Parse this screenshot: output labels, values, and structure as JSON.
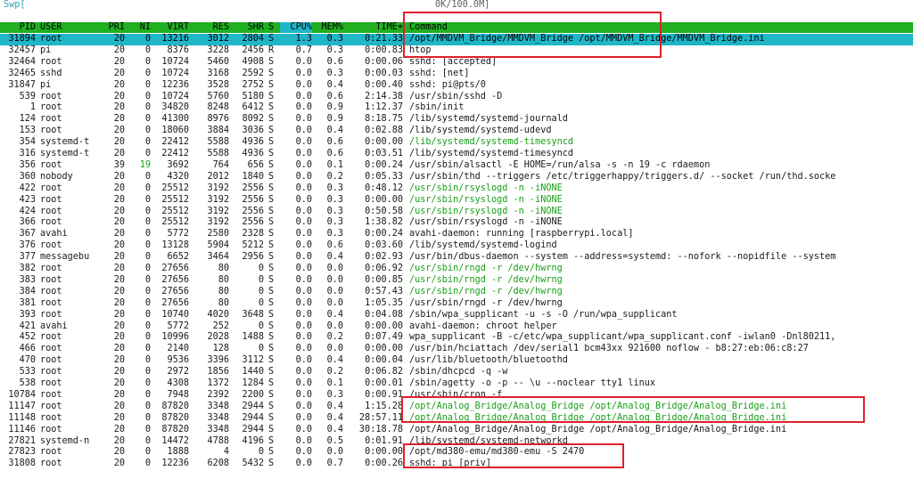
{
  "swap": {
    "label": "Swp[",
    "value": "0K/100.0M]"
  },
  "columns": {
    "pid": "PID",
    "user": "USER",
    "pri": "PRI",
    "ni": "NI",
    "virt": "VIRT",
    "res": "RES",
    "shr": "SHR",
    "s": "S",
    "cpu": "CPU%",
    "mem": "MEM%",
    "time": "TIME+",
    "command": "Command"
  },
  "colors": {
    "header_bg": "#20b020",
    "selected_bg": "#1fb6c8",
    "highlight_box": "#e0202a",
    "swap_text": "#2aa6b8",
    "thread_text": "#18a018"
  },
  "processes": [
    {
      "pid": "31894",
      "user": "root",
      "pri": "20",
      "ni": "0",
      "virt": "13216",
      "res": "3012",
      "shr": "2804",
      "s": "S",
      "cpu": "1.3",
      "mem": "0.3",
      "time": "0:21.33",
      "cmd": "/opt/MMDVM_Bridge/MMDVM_Bridge /opt/MMDVM_Bridge/MMDVM_Bridge.ini",
      "selected": true
    },
    {
      "pid": "32457",
      "user": "pi",
      "pri": "20",
      "ni": "0",
      "virt": "8376",
      "res": "3228",
      "shr": "2456",
      "s": "R",
      "cpu": "0.7",
      "mem": "0.3",
      "time": "0:00.83",
      "cmd": "htop"
    },
    {
      "pid": "32464",
      "user": "root",
      "pri": "20",
      "ni": "0",
      "virt": "10724",
      "res": "5460",
      "shr": "4908",
      "s": "S",
      "cpu": "0.0",
      "mem": "0.6",
      "time": "0:00.06",
      "cmd": "sshd: [accepted]"
    },
    {
      "pid": "32465",
      "user": "sshd",
      "pri": "20",
      "ni": "0",
      "virt": "10724",
      "res": "3168",
      "shr": "2592",
      "s": "S",
      "cpu": "0.0",
      "mem": "0.3",
      "time": "0:00.03",
      "cmd": "sshd: [net]"
    },
    {
      "pid": "31847",
      "user": "pi",
      "pri": "20",
      "ni": "0",
      "virt": "12236",
      "res": "3528",
      "shr": "2752",
      "s": "S",
      "cpu": "0.0",
      "mem": "0.4",
      "time": "0:00.40",
      "cmd": "sshd: pi@pts/0"
    },
    {
      "pid": "539",
      "user": "root",
      "pri": "20",
      "ni": "0",
      "virt": "10724",
      "res": "5760",
      "shr": "5180",
      "s": "S",
      "cpu": "0.0",
      "mem": "0.6",
      "time": "2:14.38",
      "cmd": "/usr/sbin/sshd -D"
    },
    {
      "pid": "1",
      "user": "root",
      "pri": "20",
      "ni": "0",
      "virt": "34820",
      "res": "8248",
      "shr": "6412",
      "s": "S",
      "cpu": "0.0",
      "mem": "0.9",
      "time": "1:12.37",
      "cmd": "/sbin/init"
    },
    {
      "pid": "124",
      "user": "root",
      "pri": "20",
      "ni": "0",
      "virt": "41300",
      "res": "8976",
      "shr": "8092",
      "s": "S",
      "cpu": "0.0",
      "mem": "0.9",
      "time": "8:18.75",
      "cmd": "/lib/systemd/systemd-journald"
    },
    {
      "pid": "153",
      "user": "root",
      "pri": "20",
      "ni": "0",
      "virt": "18060",
      "res": "3884",
      "shr": "3036",
      "s": "S",
      "cpu": "0.0",
      "mem": "0.4",
      "time": "0:02.88",
      "cmd": "/lib/systemd/systemd-udevd"
    },
    {
      "pid": "354",
      "user": "systemd-t",
      "pri": "20",
      "ni": "0",
      "virt": "22412",
      "res": "5588",
      "shr": "4936",
      "s": "S",
      "cpu": "0.0",
      "mem": "0.6",
      "time": "0:00.00",
      "cmd": "/lib/systemd/systemd-timesyncd",
      "thread": true
    },
    {
      "pid": "316",
      "user": "systemd-t",
      "pri": "20",
      "ni": "0",
      "virt": "22412",
      "res": "5588",
      "shr": "4936",
      "s": "S",
      "cpu": "0.0",
      "mem": "0.6",
      "time": "0:03.51",
      "cmd": "/lib/systemd/systemd-timesyncd"
    },
    {
      "pid": "356",
      "user": "root",
      "pri": "39",
      "ni": "19",
      "virt": "3692",
      "res": "764",
      "shr": "656",
      "s": "S",
      "cpu": "0.0",
      "mem": "0.1",
      "time": "0:00.24",
      "cmd": "/usr/sbin/alsactl -E HOME=/run/alsa -s -n 19 -c rdaemon"
    },
    {
      "pid": "360",
      "user": "nobody",
      "pri": "20",
      "ni": "0",
      "virt": "4320",
      "res": "2012",
      "shr": "1840",
      "s": "S",
      "cpu": "0.0",
      "mem": "0.2",
      "time": "0:05.33",
      "cmd": "/usr/sbin/thd --triggers /etc/triggerhappy/triggers.d/ --socket /run/thd.socke"
    },
    {
      "pid": "422",
      "user": "root",
      "pri": "20",
      "ni": "0",
      "virt": "25512",
      "res": "3192",
      "shr": "2556",
      "s": "S",
      "cpu": "0.0",
      "mem": "0.3",
      "time": "0:48.12",
      "cmd": "/usr/sbin/rsyslogd -n -iNONE",
      "thread": true
    },
    {
      "pid": "423",
      "user": "root",
      "pri": "20",
      "ni": "0",
      "virt": "25512",
      "res": "3192",
      "shr": "2556",
      "s": "S",
      "cpu": "0.0",
      "mem": "0.3",
      "time": "0:00.00",
      "cmd": "/usr/sbin/rsyslogd -n -iNONE",
      "thread": true
    },
    {
      "pid": "424",
      "user": "root",
      "pri": "20",
      "ni": "0",
      "virt": "25512",
      "res": "3192",
      "shr": "2556",
      "s": "S",
      "cpu": "0.0",
      "mem": "0.3",
      "time": "0:50.58",
      "cmd": "/usr/sbin/rsyslogd -n -iNONE",
      "thread": true
    },
    {
      "pid": "366",
      "user": "root",
      "pri": "20",
      "ni": "0",
      "virt": "25512",
      "res": "3192",
      "shr": "2556",
      "s": "S",
      "cpu": "0.0",
      "mem": "0.3",
      "time": "1:38.82",
      "cmd": "/usr/sbin/rsyslogd -n -iNONE"
    },
    {
      "pid": "367",
      "user": "avahi",
      "pri": "20",
      "ni": "0",
      "virt": "5772",
      "res": "2580",
      "shr": "2328",
      "s": "S",
      "cpu": "0.0",
      "mem": "0.3",
      "time": "0:00.24",
      "cmd": "avahi-daemon: running [raspberrypi.local]"
    },
    {
      "pid": "376",
      "user": "root",
      "pri": "20",
      "ni": "0",
      "virt": "13128",
      "res": "5904",
      "shr": "5212",
      "s": "S",
      "cpu": "0.0",
      "mem": "0.6",
      "time": "0:03.60",
      "cmd": "/lib/systemd/systemd-logind"
    },
    {
      "pid": "377",
      "user": "messagebu",
      "pri": "20",
      "ni": "0",
      "virt": "6652",
      "res": "3464",
      "shr": "2956",
      "s": "S",
      "cpu": "0.0",
      "mem": "0.4",
      "time": "0:02.93",
      "cmd": "/usr/bin/dbus-daemon --system --address=systemd: --nofork --nopidfile --system"
    },
    {
      "pid": "382",
      "user": "root",
      "pri": "20",
      "ni": "0",
      "virt": "27656",
      "res": "80",
      "shr": "0",
      "s": "S",
      "cpu": "0.0",
      "mem": "0.0",
      "time": "0:06.92",
      "cmd": "/usr/sbin/rngd -r /dev/hwrng",
      "thread": true
    },
    {
      "pid": "383",
      "user": "root",
      "pri": "20",
      "ni": "0",
      "virt": "27656",
      "res": "80",
      "shr": "0",
      "s": "S",
      "cpu": "0.0",
      "mem": "0.0",
      "time": "0:00.85",
      "cmd": "/usr/sbin/rngd -r /dev/hwrng",
      "thread": true
    },
    {
      "pid": "384",
      "user": "root",
      "pri": "20",
      "ni": "0",
      "virt": "27656",
      "res": "80",
      "shr": "0",
      "s": "S",
      "cpu": "0.0",
      "mem": "0.0",
      "time": "0:57.43",
      "cmd": "/usr/sbin/rngd -r /dev/hwrng",
      "thread": true
    },
    {
      "pid": "381",
      "user": "root",
      "pri": "20",
      "ni": "0",
      "virt": "27656",
      "res": "80",
      "shr": "0",
      "s": "S",
      "cpu": "0.0",
      "mem": "0.0",
      "time": "1:05.35",
      "cmd": "/usr/sbin/rngd -r /dev/hwrng"
    },
    {
      "pid": "393",
      "user": "root",
      "pri": "20",
      "ni": "0",
      "virt": "10740",
      "res": "4020",
      "shr": "3648",
      "s": "S",
      "cpu": "0.0",
      "mem": "0.4",
      "time": "0:04.08",
      "cmd": "/sbin/wpa_supplicant -u -s -O /run/wpa_supplicant"
    },
    {
      "pid": "421",
      "user": "avahi",
      "pri": "20",
      "ni": "0",
      "virt": "5772",
      "res": "252",
      "shr": "0",
      "s": "S",
      "cpu": "0.0",
      "mem": "0.0",
      "time": "0:00.00",
      "cmd": "avahi-daemon: chroot helper"
    },
    {
      "pid": "452",
      "user": "root",
      "pri": "20",
      "ni": "0",
      "virt": "10996",
      "res": "2028",
      "shr": "1488",
      "s": "S",
      "cpu": "0.0",
      "mem": "0.2",
      "time": "0:07.49",
      "cmd": "wpa_supplicant -B -c/etc/wpa_supplicant/wpa_supplicant.conf -iwlan0 -Dnl80211,"
    },
    {
      "pid": "466",
      "user": "root",
      "pri": "20",
      "ni": "0",
      "virt": "2140",
      "res": "128",
      "shr": "0",
      "s": "S",
      "cpu": "0.0",
      "mem": "0.0",
      "time": "0:00.00",
      "cmd": "/usr/bin/hciattach /dev/serial1 bcm43xx 921600 noflow - b8:27:eb:06:c8:27"
    },
    {
      "pid": "470",
      "user": "root",
      "pri": "20",
      "ni": "0",
      "virt": "9536",
      "res": "3396",
      "shr": "3112",
      "s": "S",
      "cpu": "0.0",
      "mem": "0.4",
      "time": "0:00.04",
      "cmd": "/usr/lib/bluetooth/bluetoothd"
    },
    {
      "pid": "533",
      "user": "root",
      "pri": "20",
      "ni": "0",
      "virt": "2972",
      "res": "1856",
      "shr": "1440",
      "s": "S",
      "cpu": "0.0",
      "mem": "0.2",
      "time": "0:06.82",
      "cmd": "/sbin/dhcpcd -q -w"
    },
    {
      "pid": "538",
      "user": "root",
      "pri": "20",
      "ni": "0",
      "virt": "4308",
      "res": "1372",
      "shr": "1284",
      "s": "S",
      "cpu": "0.0",
      "mem": "0.1",
      "time": "0:00.01",
      "cmd": "/sbin/agetty -o -p -- \\u --noclear tty1 linux"
    },
    {
      "pid": "10784",
      "user": "root",
      "pri": "20",
      "ni": "0",
      "virt": "7948",
      "res": "2392",
      "shr": "2200",
      "s": "S",
      "cpu": "0.0",
      "mem": "0.3",
      "time": "0:00.91",
      "cmd": "/usr/sbin/cron -f"
    },
    {
      "pid": "11147",
      "user": "root",
      "pri": "20",
      "ni": "0",
      "virt": "87820",
      "res": "3348",
      "shr": "2944",
      "s": "S",
      "cpu": "0.0",
      "mem": "0.4",
      "time": "1:15.28",
      "cmd": "/opt/Analog_Bridge/Analog_Bridge /opt/Analog_Bridge/Analog_Bridge.ini",
      "thread": true
    },
    {
      "pid": "11148",
      "user": "root",
      "pri": "20",
      "ni": "0",
      "virt": "87820",
      "res": "3348",
      "shr": "2944",
      "s": "S",
      "cpu": "0.0",
      "mem": "0.4",
      "time": "28:57.11",
      "cmd": "/opt/Analog_Bridge/Analog_Bridge /opt/Analog_Bridge/Analog_Bridge.ini",
      "thread": true
    },
    {
      "pid": "11146",
      "user": "root",
      "pri": "20",
      "ni": "0",
      "virt": "87820",
      "res": "3348",
      "shr": "2944",
      "s": "S",
      "cpu": "0.0",
      "mem": "0.4",
      "time": "30:18.78",
      "cmd": "/opt/Analog_Bridge/Analog_Bridge /opt/Analog_Bridge/Analog_Bridge.ini"
    },
    {
      "pid": "27821",
      "user": "systemd-n",
      "pri": "20",
      "ni": "0",
      "virt": "14472",
      "res": "4788",
      "shr": "4196",
      "s": "S",
      "cpu": "0.0",
      "mem": "0.5",
      "time": "0:01.91",
      "cmd": "/lib/systemd/systemd-networkd"
    },
    {
      "pid": "27823",
      "user": "root",
      "pri": "20",
      "ni": "0",
      "virt": "1888",
      "res": "4",
      "shr": "0",
      "s": "S",
      "cpu": "0.0",
      "mem": "0.0",
      "time": "0:00.00",
      "cmd": "/opt/md380-emu/md380-emu -S 2470"
    },
    {
      "pid": "31808",
      "user": "root",
      "pri": "20",
      "ni": "0",
      "virt": "12236",
      "res": "6208",
      "shr": "5432",
      "s": "S",
      "cpu": "0.0",
      "mem": "0.7",
      "time": "0:00.26",
      "cmd": "sshd: pi [priv]"
    }
  ]
}
